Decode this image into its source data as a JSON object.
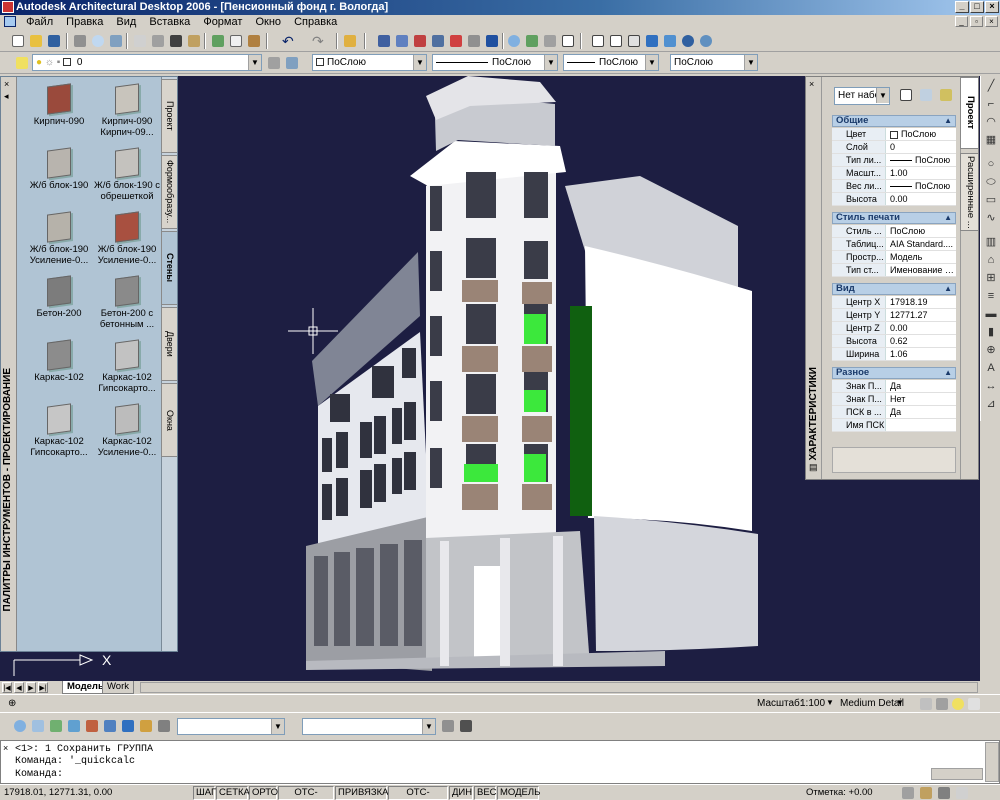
{
  "app": {
    "title": "Autodesk Architectural Desktop 2006 - [Пенсионный фонд г. Вологда]"
  },
  "menu": [
    "Файл",
    "Правка",
    "Вид",
    "Вставка",
    "Формат",
    "Окно",
    "Справка"
  ],
  "layers_toolbar": {
    "layer_value": "0",
    "color": "ПоСлою",
    "linetype": "ПоСлою",
    "lineweight": "ПоСлою",
    "plotstyle": "ПоСлою"
  },
  "tool_palette": {
    "title": "ПАЛИТРЫ ИНСТРУМЕНТОВ - ПРОЕКТИРОВАНИЕ",
    "tabs": [
      "Проект",
      "Формообразу...",
      "Стены",
      "Двери",
      "Окна"
    ],
    "active_tab": "Стены",
    "tools": [
      {
        "label": "Кирпич-090",
        "color": "#9a4a3c"
      },
      {
        "label": "Кирпич-090 Кирпич-09...",
        "color": "#c8c4bc"
      },
      {
        "label": "Ж/б блок-190",
        "color": "#b8b4ae"
      },
      {
        "label": "Ж/б блок-190 с обрешеткой",
        "color": "#c4c2be"
      },
      {
        "label": "Ж/б блок-190 Усиление-0...",
        "color": "#b6b2aa"
      },
      {
        "label": "Ж/б блок-190 Усиление-0...",
        "color": "#a85040"
      },
      {
        "label": "Бетон-200",
        "color": "#7c7c7c"
      },
      {
        "label": "Бетон-200 с бетонным ...",
        "color": "#8a8a8a"
      },
      {
        "label": "Каркас-102",
        "color": "#8c8c8c"
      },
      {
        "label": "Каркас-102 Гипсокарто...",
        "color": "#c2c2c2"
      },
      {
        "label": "Каркас-102 Гипсокарто...",
        "color": "#c6c6c6"
      },
      {
        "label": "Каркас-102 Усиление-0...",
        "color": "#bcbcbc"
      }
    ]
  },
  "properties": {
    "title": "ХАРАКТЕРИСТИКИ",
    "tabs": [
      "Проект",
      "Расширенные ..."
    ],
    "selection": "Нет набор",
    "sections": [
      {
        "title": "Общие",
        "rows": [
          {
            "k": "Цвет",
            "v": "ПоСлою",
            "kind": "check"
          },
          {
            "k": "Слой",
            "v": "0"
          },
          {
            "k": "Тип ли...",
            "v": "ПоСлою",
            "kind": "line"
          },
          {
            "k": "Масшт...",
            "v": "1.00"
          },
          {
            "k": "Вес ли...",
            "v": "ПоСлою",
            "kind": "line"
          },
          {
            "k": "Высота",
            "v": "0.00"
          }
        ]
      },
      {
        "title": "Стиль печати",
        "rows": [
          {
            "k": "Стиль ...",
            "v": "ПоСлою"
          },
          {
            "k": "Таблиц...",
            "v": "AIA Standard...."
          },
          {
            "k": "Простр...",
            "v": "Модель"
          },
          {
            "k": "Тип ст...",
            "v": "Именование б..."
          }
        ]
      },
      {
        "title": "Вид",
        "rows": [
          {
            "k": "Центр X",
            "v": "17918.19"
          },
          {
            "k": "Центр Y",
            "v": "12771.27"
          },
          {
            "k": "Центр Z",
            "v": "0.00"
          },
          {
            "k": "Высота",
            "v": "0.62"
          },
          {
            "k": "Ширина",
            "v": "1.06"
          }
        ]
      },
      {
        "title": "Разное",
        "rows": [
          {
            "k": "Знак П...",
            "v": "Да"
          },
          {
            "k": "Знак П...",
            "v": "Нет"
          },
          {
            "k": "ПСК в ...",
            "v": "Да"
          },
          {
            "k": "Имя ПСК",
            "v": ""
          }
        ]
      }
    ]
  },
  "layout_tabs": {
    "model": "Модель",
    "work": "Work"
  },
  "drawing_status": {
    "scale_label": "Масштаб:",
    "scale_value": "1:100",
    "detail": "Medium Detail"
  },
  "command": {
    "lines": [
      "<1>: 1 Сохранить ГРУППА",
      "Команда: '_quickcalc",
      "Команда:"
    ]
  },
  "status": {
    "coords": "17918.01, 12771.31, 0.00",
    "buttons": [
      "ШАГ",
      "СЕТКА",
      "ОРТО",
      "ОТС-ПОЛЯР",
      "ПРИВЯЗКА",
      "ОТС-ОБЪЕКТ",
      "ДИН",
      "ВЕС",
      "МОДЕЛЬ"
    ],
    "elevation": "Отметка: +0.00"
  },
  "ucs": {
    "x_label": "X"
  }
}
